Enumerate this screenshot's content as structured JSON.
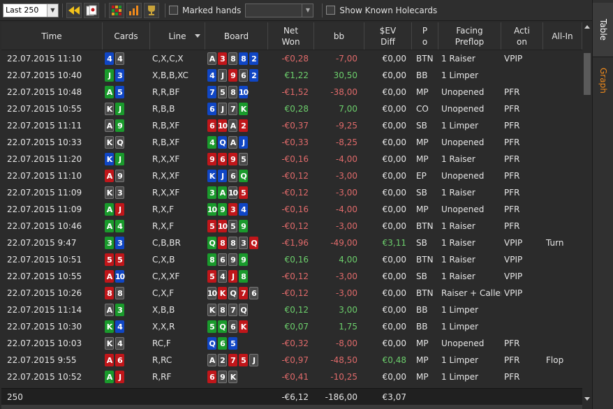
{
  "toolbar": {
    "range_select": "Last 250",
    "marked_hands_label": "Marked hands",
    "marked_hands_value": "",
    "show_known_holecards_label": "Show Known Holecards"
  },
  "side_tabs": {
    "table": "Table",
    "graph": "Graph"
  },
  "columns": [
    {
      "key": "time",
      "label": "Time"
    },
    {
      "key": "cards",
      "label": "Cards"
    },
    {
      "key": "line",
      "label": "Line"
    },
    {
      "key": "board",
      "label": "Board"
    },
    {
      "key": "net",
      "label": "Net\nWon"
    },
    {
      "key": "bb",
      "label": "bb"
    },
    {
      "key": "ev",
      "label": "$EV\nDiff"
    },
    {
      "key": "pos",
      "label": "P\no"
    },
    {
      "key": "facing",
      "label": "Facing\nPreflop"
    },
    {
      "key": "action",
      "label": "Acti\non"
    },
    {
      "key": "allin",
      "label": "All-In"
    }
  ],
  "colors": {
    "clubs": "#1a9a2c",
    "diamonds": "#1046c4",
    "hearts": "#c0161a",
    "spades": "#4a4a4a",
    "negative": "#e06a6a",
    "positive": "#6ccf6c"
  },
  "rows": [
    {
      "time": "22.07.2015 11:10",
      "cards": [
        [
          "4",
          "d"
        ],
        [
          "4",
          "s"
        ]
      ],
      "line": "C,X,C,X",
      "board": [
        [
          "A",
          "s"
        ],
        [
          "3",
          "h"
        ],
        [
          "8",
          "s"
        ],
        [
          "8",
          "d"
        ],
        [
          "2",
          "d"
        ]
      ],
      "net": "-€0,28",
      "bb": "-7,00",
      "ev": "€0,00",
      "pos": "BTN",
      "facing": "1 Raiser",
      "action": "VPIP",
      "allin": ""
    },
    {
      "time": "22.07.2015 10:40",
      "cards": [
        [
          "J",
          "c"
        ],
        [
          "3",
          "d"
        ]
      ],
      "line": "X,B,B,XC",
      "board": [
        [
          "4",
          "d"
        ],
        [
          "J",
          "s"
        ],
        [
          "9",
          "h"
        ],
        [
          "6",
          "s"
        ],
        [
          "2",
          "d"
        ]
      ],
      "net": "€1,22",
      "bb": "30,50",
      "ev": "€0,00",
      "pos": "BB",
      "facing": "1 Limper",
      "action": "",
      "allin": ""
    },
    {
      "time": "22.07.2015 10:48",
      "cards": [
        [
          "A",
          "c"
        ],
        [
          "5",
          "d"
        ]
      ],
      "line": "R,R,BF",
      "board": [
        [
          "7",
          "d"
        ],
        [
          "5",
          "s"
        ],
        [
          "8",
          "s"
        ],
        [
          "10",
          "d"
        ]
      ],
      "net": "-€1,52",
      "bb": "-38,00",
      "ev": "€0,00",
      "pos": "MP",
      "facing": "Unopened",
      "action": "PFR",
      "allin": ""
    },
    {
      "time": "22.07.2015 10:55",
      "cards": [
        [
          "K",
          "s"
        ],
        [
          "J",
          "c"
        ]
      ],
      "line": "R,B,B",
      "board": [
        [
          "6",
          "d"
        ],
        [
          "J",
          "s"
        ],
        [
          "7",
          "s"
        ],
        [
          "K",
          "c"
        ]
      ],
      "net": "€0,28",
      "bb": "7,00",
      "ev": "€0,00",
      "pos": "CO",
      "facing": "Unopened",
      "action": "PFR",
      "allin": ""
    },
    {
      "time": "22.07.2015 11:11",
      "cards": [
        [
          "A",
          "s"
        ],
        [
          "9",
          "c"
        ]
      ],
      "line": "R,B,XF",
      "board": [
        [
          "6",
          "h"
        ],
        [
          "10",
          "h"
        ],
        [
          "A",
          "s"
        ],
        [
          "2",
          "h"
        ]
      ],
      "net": "-€0,37",
      "bb": "-9,25",
      "ev": "€0,00",
      "pos": "SB",
      "facing": "1 Limper",
      "action": "PFR",
      "allin": ""
    },
    {
      "time": "22.07.2015 10:33",
      "cards": [
        [
          "K",
          "s"
        ],
        [
          "Q",
          "s"
        ]
      ],
      "line": "R,B,XF",
      "board": [
        [
          "4",
          "c"
        ],
        [
          "Q",
          "d"
        ],
        [
          "A",
          "s"
        ],
        [
          "J",
          "d"
        ]
      ],
      "net": "-€0,33",
      "bb": "-8,25",
      "ev": "€0,00",
      "pos": "MP",
      "facing": "Unopened",
      "action": "PFR",
      "allin": ""
    },
    {
      "time": "22.07.2015 11:20",
      "cards": [
        [
          "K",
          "d"
        ],
        [
          "J",
          "c"
        ]
      ],
      "line": "R,X,XF",
      "board": [
        [
          "9",
          "h"
        ],
        [
          "6",
          "h"
        ],
        [
          "9",
          "h"
        ],
        [
          "5",
          "s"
        ]
      ],
      "net": "-€0,16",
      "bb": "-4,00",
      "ev": "€0,00",
      "pos": "MP",
      "facing": "1 Raiser",
      "action": "PFR",
      "allin": ""
    },
    {
      "time": "22.07.2015 11:10",
      "cards": [
        [
          "A",
          "h"
        ],
        [
          "9",
          "s"
        ]
      ],
      "line": "R,X,XF",
      "board": [
        [
          "K",
          "d"
        ],
        [
          "J",
          "d"
        ],
        [
          "6",
          "s"
        ],
        [
          "Q",
          "c"
        ]
      ],
      "net": "-€0,12",
      "bb": "-3,00",
      "ev": "€0,00",
      "pos": "EP",
      "facing": "Unopened",
      "action": "PFR",
      "allin": ""
    },
    {
      "time": "22.07.2015 11:09",
      "cards": [
        [
          "K",
          "s"
        ],
        [
          "3",
          "s"
        ]
      ],
      "line": "R,X,XF",
      "board": [
        [
          "3",
          "c"
        ],
        [
          "A",
          "c"
        ],
        [
          "10",
          "s"
        ],
        [
          "5",
          "h"
        ]
      ],
      "net": "-€0,12",
      "bb": "-3,00",
      "ev": "€0,00",
      "pos": "SB",
      "facing": "1 Raiser",
      "action": "PFR",
      "allin": ""
    },
    {
      "time": "22.07.2015 11:09",
      "cards": [
        [
          "A",
          "c"
        ],
        [
          "J",
          "h"
        ]
      ],
      "line": "R,X,F",
      "board": [
        [
          "10",
          "c"
        ],
        [
          "9",
          "c"
        ],
        [
          "3",
          "h"
        ],
        [
          "4",
          "d"
        ]
      ],
      "net": "-€0,16",
      "bb": "-4,00",
      "ev": "€0,00",
      "pos": "MP",
      "facing": "Unopened",
      "action": "PFR",
      "allin": ""
    },
    {
      "time": "22.07.2015 10:46",
      "cards": [
        [
          "A",
          "c"
        ],
        [
          "4",
          "c"
        ]
      ],
      "line": "R,X,F",
      "board": [
        [
          "5",
          "h"
        ],
        [
          "10",
          "h"
        ],
        [
          "5",
          "s"
        ],
        [
          "9",
          "c"
        ]
      ],
      "net": "-€0,12",
      "bb": "-3,00",
      "ev": "€0,00",
      "pos": "BTN",
      "facing": "1 Raiser",
      "action": "PFR",
      "allin": ""
    },
    {
      "time": "22.07.2015 9:47",
      "cards": [
        [
          "3",
          "c"
        ],
        [
          "3",
          "d"
        ]
      ],
      "line": "C,B,BR",
      "board": [
        [
          "Q",
          "c"
        ],
        [
          "8",
          "h"
        ],
        [
          "8",
          "s"
        ],
        [
          "3",
          "s"
        ],
        [
          "Q",
          "h"
        ]
      ],
      "net": "-€1,96",
      "bb": "-49,00",
      "ev": "€3,11",
      "pos": "SB",
      "facing": "1 Raiser",
      "action": "VPIP",
      "allin": "Turn"
    },
    {
      "time": "22.07.2015 10:51",
      "cards": [
        [
          "5",
          "h"
        ],
        [
          "5",
          "h"
        ]
      ],
      "line": "C,X,B",
      "board": [
        [
          "8",
          "c"
        ],
        [
          "6",
          "s"
        ],
        [
          "9",
          "s"
        ],
        [
          "9",
          "c"
        ]
      ],
      "net": "€0,16",
      "bb": "4,00",
      "ev": "€0,00",
      "pos": "BTN",
      "facing": "1 Raiser",
      "action": "VPIP",
      "allin": ""
    },
    {
      "time": "22.07.2015 10:55",
      "cards": [
        [
          "A",
          "h"
        ],
        [
          "10",
          "d"
        ]
      ],
      "line": "C,X,XF",
      "board": [
        [
          "5",
          "h"
        ],
        [
          "4",
          "s"
        ],
        [
          "J",
          "h"
        ],
        [
          "8",
          "c"
        ]
      ],
      "net": "-€0,12",
      "bb": "-3,00",
      "ev": "€0,00",
      "pos": "SB",
      "facing": "1 Raiser",
      "action": "VPIP",
      "allin": ""
    },
    {
      "time": "22.07.2015 10:26",
      "cards": [
        [
          "8",
          "h"
        ],
        [
          "8",
          "s"
        ]
      ],
      "line": "C,X,F",
      "board": [
        [
          "10",
          "s"
        ],
        [
          "K",
          "h"
        ],
        [
          "Q",
          "s"
        ],
        [
          "7",
          "h"
        ],
        [
          "6",
          "s"
        ]
      ],
      "net": "-€0,12",
      "bb": "-3,00",
      "ev": "€0,00",
      "pos": "BTN",
      "facing": "Raiser + Callers",
      "action": "VPIP",
      "allin": ""
    },
    {
      "time": "22.07.2015 11:14",
      "cards": [
        [
          "A",
          "s"
        ],
        [
          "3",
          "c"
        ]
      ],
      "line": "X,B,B",
      "board": [
        [
          "K",
          "s"
        ],
        [
          "8",
          "s"
        ],
        [
          "7",
          "s"
        ],
        [
          "Q",
          "s"
        ]
      ],
      "net": "€0,12",
      "bb": "3,00",
      "ev": "€0,00",
      "pos": "BB",
      "facing": "1 Limper",
      "action": "",
      "allin": ""
    },
    {
      "time": "22.07.2015 10:30",
      "cards": [
        [
          "K",
          "c"
        ],
        [
          "4",
          "d"
        ]
      ],
      "line": "X,X,R",
      "board": [
        [
          "5",
          "c"
        ],
        [
          "Q",
          "c"
        ],
        [
          "6",
          "s"
        ],
        [
          "K",
          "h"
        ]
      ],
      "net": "€0,07",
      "bb": "1,75",
      "ev": "€0,00",
      "pos": "BB",
      "facing": "1 Limper",
      "action": "",
      "allin": ""
    },
    {
      "time": "22.07.2015 10:03",
      "cards": [
        [
          "K",
          "s"
        ],
        [
          "4",
          "s"
        ]
      ],
      "line": "RC,F",
      "board": [
        [
          "Q",
          "d"
        ],
        [
          "6",
          "c"
        ],
        [
          "5",
          "d"
        ]
      ],
      "net": "-€0,32",
      "bb": "-8,00",
      "ev": "€0,00",
      "pos": "MP",
      "facing": "Unopened",
      "action": "PFR",
      "allin": ""
    },
    {
      "time": "22.07.2015 9:55",
      "cards": [
        [
          "A",
          "h"
        ],
        [
          "6",
          "h"
        ]
      ],
      "line": "R,RC",
      "board": [
        [
          "A",
          "s"
        ],
        [
          "2",
          "s"
        ],
        [
          "7",
          "h"
        ],
        [
          "5",
          "h"
        ],
        [
          "J",
          "s"
        ]
      ],
      "net": "-€0,97",
      "bb": "-48,50",
      "ev": "€0,48",
      "pos": "MP",
      "facing": "1 Limper",
      "action": "PFR",
      "allin": "Flop"
    },
    {
      "time": "22.07.2015 10:52",
      "cards": [
        [
          "A",
          "c"
        ],
        [
          "J",
          "h"
        ]
      ],
      "line": "R,RF",
      "board": [
        [
          "6",
          "h"
        ],
        [
          "9",
          "s"
        ],
        [
          "K",
          "s"
        ]
      ],
      "net": "-€0,41",
      "bb": "-10,25",
      "ev": "€0,00",
      "pos": "MP",
      "facing": "1 Limper",
      "action": "PFR",
      "allin": ""
    }
  ],
  "footer": {
    "count": "250",
    "net_total": "-€6,12",
    "bb_total": "-186,00",
    "ev_total": "€3,07"
  }
}
